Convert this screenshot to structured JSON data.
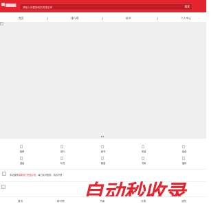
{
  "header": {
    "logo_text": "█████",
    "search_placeholder": "请输入你要搜索的资源名称",
    "search_button": "搜索"
  },
  "nav": {
    "items": [
      "首页",
      "排行榜",
      "新书",
      "个人中心"
    ]
  },
  "banner": {
    "indicator_count": 3
  },
  "categories": [
    {
      "label": "推荐"
    },
    {
      "label": "排行"
    },
    {
      "label": "新书"
    },
    {
      "label": "完结"
    },
    {
      "label": "免费"
    },
    {
      "label": "漫画"
    },
    {
      "label": "听书"
    },
    {
      "label": "频道"
    },
    {
      "label": "书单"
    },
    {
      "label": "福利"
    }
  ],
  "notice": {
    "prefix": "本站推荐",
    "highlight": "最新热门完结小说",
    "suffix": "，每日实时更新，精彩不断"
  },
  "tabs": [
    "首页",
    "排行榜",
    "书架",
    "分类",
    "我的"
  ],
  "watermark": {
    "text": "自动秒收录",
    "color": "#e4242e"
  },
  "colors": {
    "brand_red": "#e4242e"
  }
}
